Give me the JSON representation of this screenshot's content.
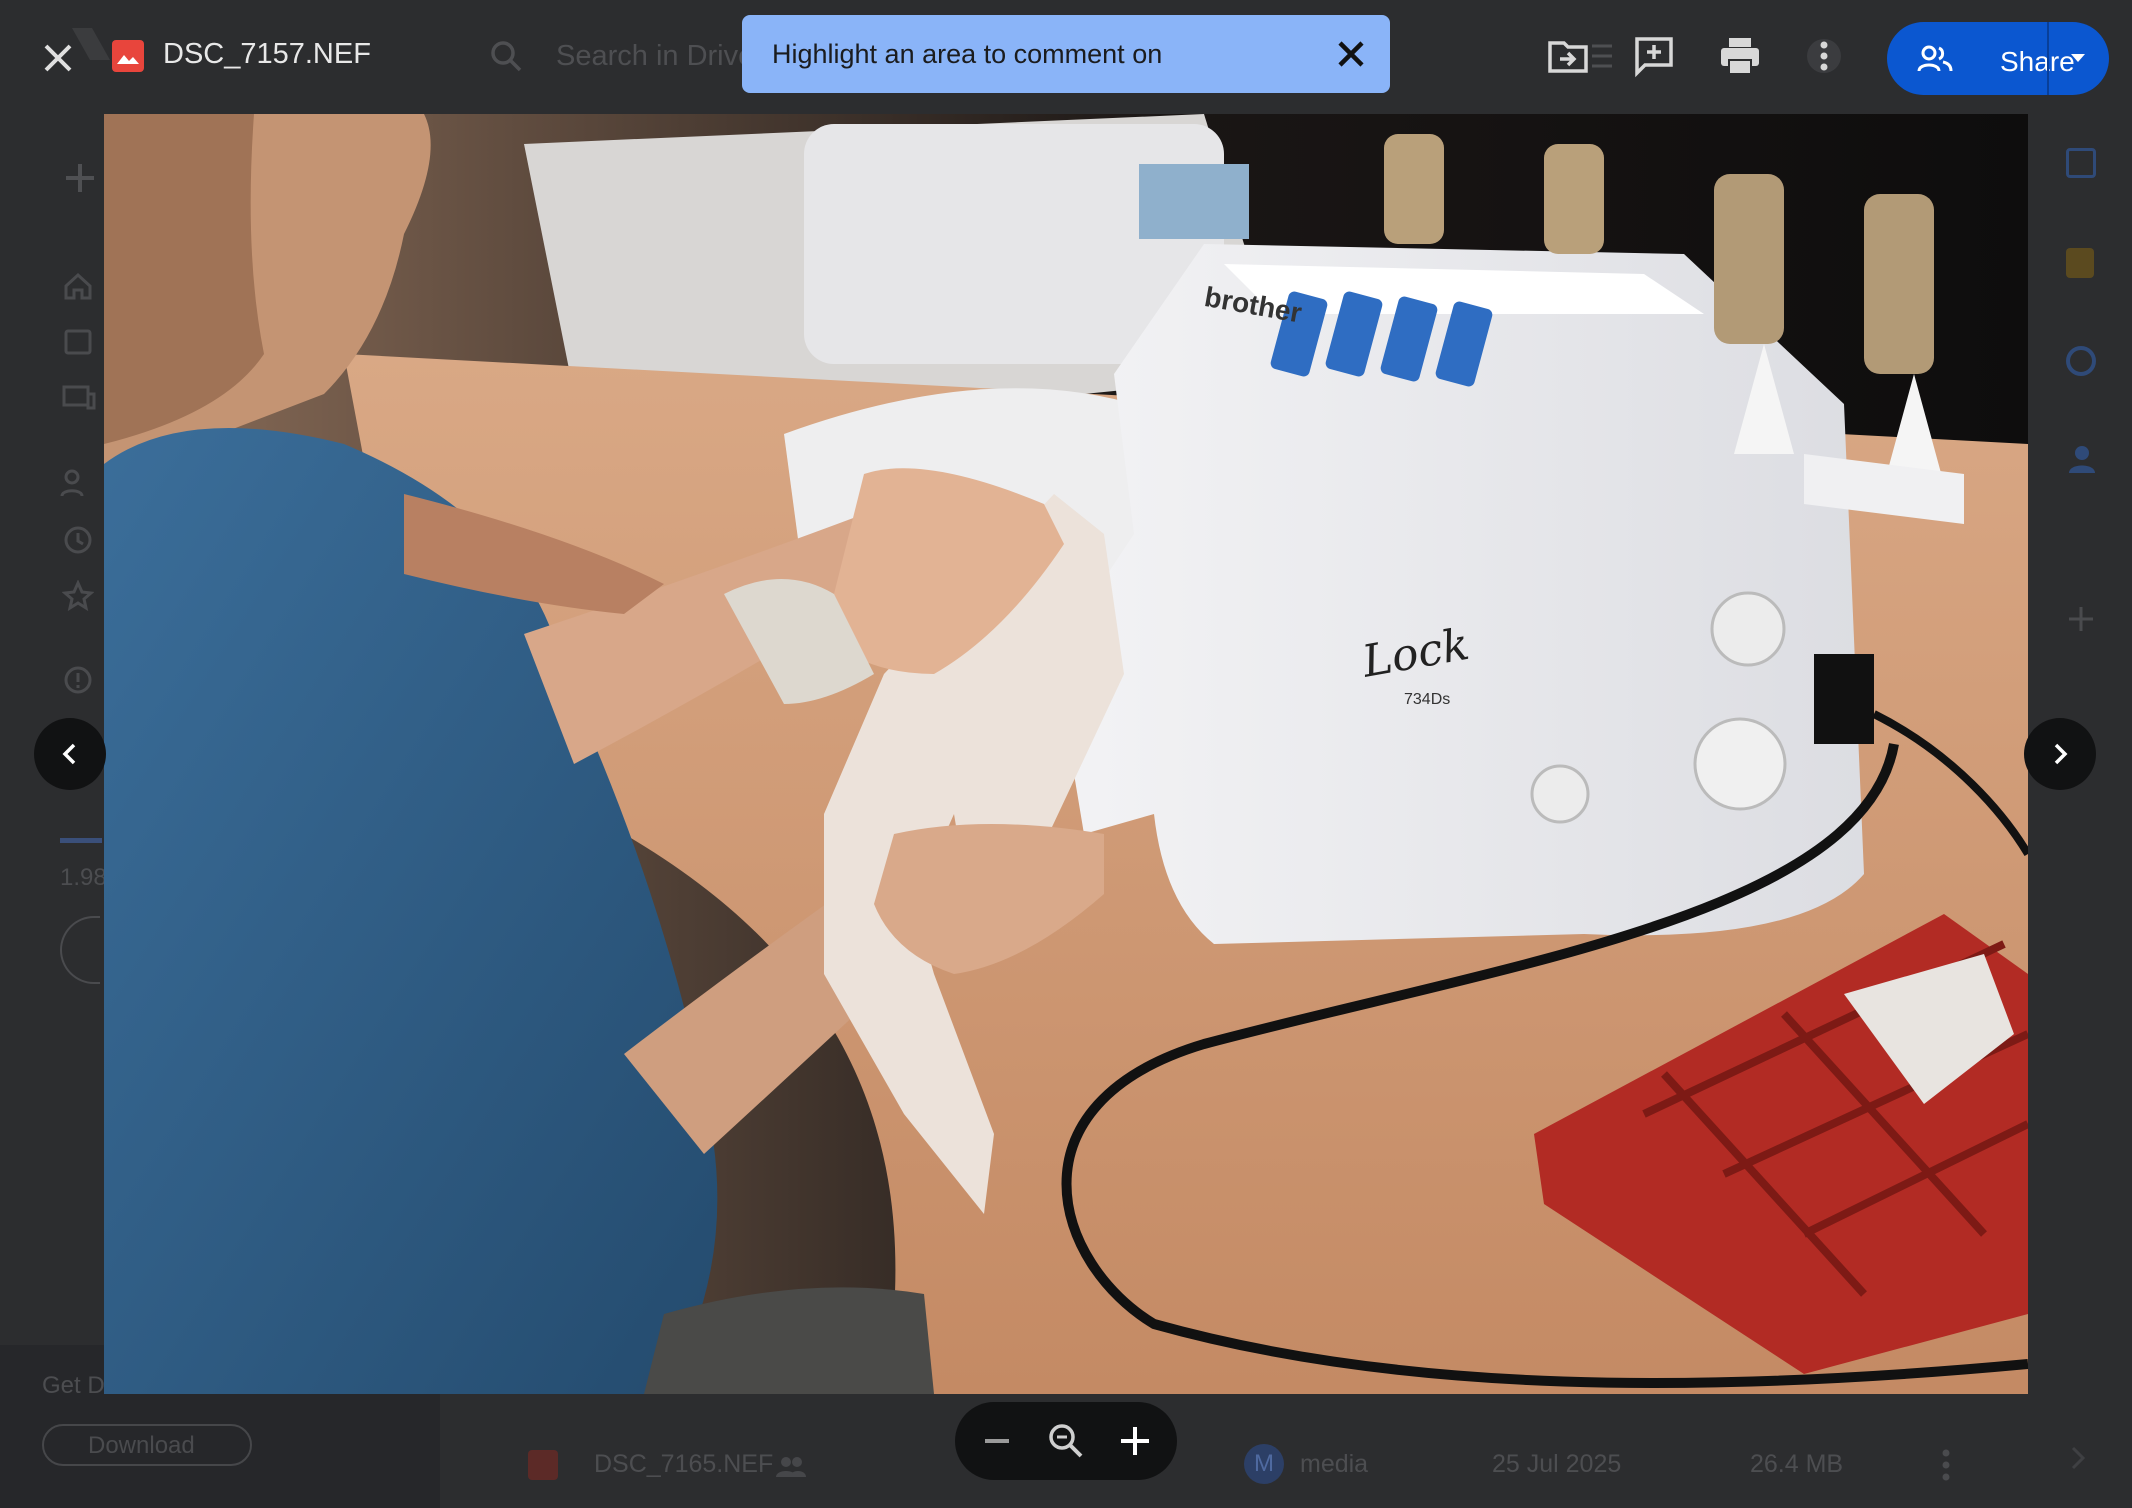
{
  "viewer": {
    "file_name": "DSC_7157.NEF",
    "search_placeholder": "Search in Drive",
    "comment_banner_text": "Highlight an area to comment on",
    "share_label": "Share"
  },
  "background_page": {
    "storage_text": "1.98",
    "promo_text": "Get D",
    "download_label": "Download",
    "file_row": {
      "name": "DSC_7165.NEF",
      "owner_initial": "M",
      "owner": "media",
      "modified": "25 Jul 2025",
      "size": "26.4 MB"
    }
  },
  "photo": {
    "subject": "person-using-brother-overlocker",
    "machine_brand": "brother",
    "machine_model": "Lock",
    "machine_number": "734Ds"
  },
  "colors": {
    "accent_blue": "#0b57d0",
    "banner_blue": "#8ab4f8",
    "file_icon_red": "#e8453c"
  }
}
